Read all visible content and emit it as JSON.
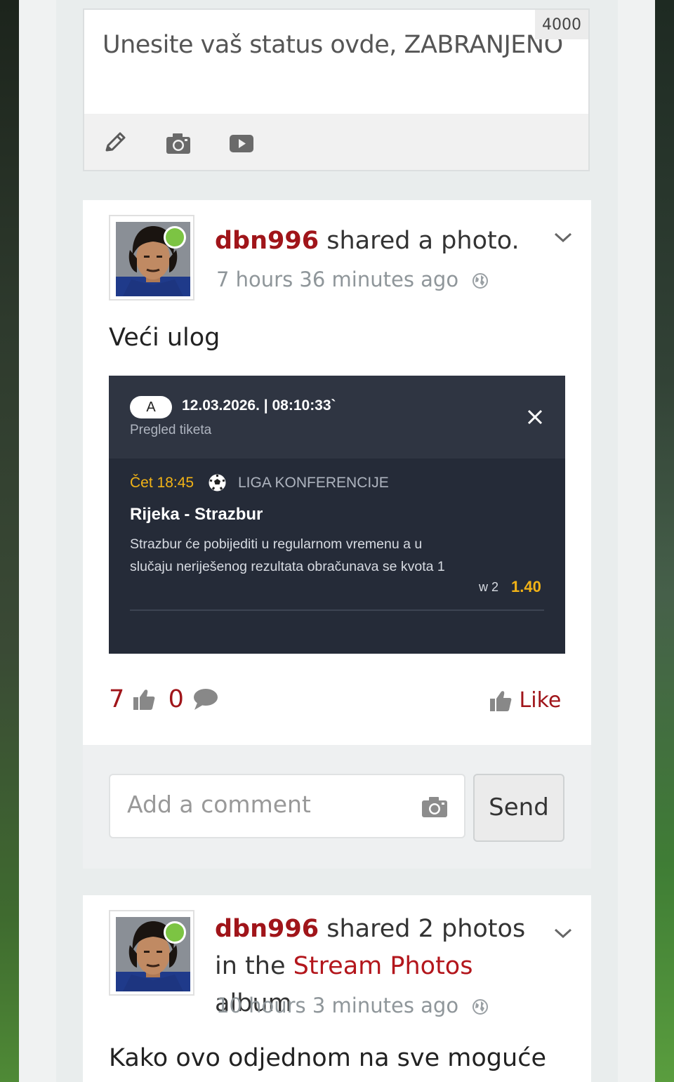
{
  "composer": {
    "placeholder": "Unesite vaš status ovde, ZABRANJENO",
    "char_counter": "4000",
    "tools": [
      "pencil-icon",
      "camera-icon",
      "video-icon"
    ]
  },
  "posts": [
    {
      "author": "dbn996",
      "action": "shared a photo.",
      "time_ago": "7 hours 36 minutes ago",
      "text": "Veći ulog",
      "ticket": {
        "badge": "A",
        "datetime": "12.03.2026. | 08:10:33`",
        "subtitle": "Pregled tiketa",
        "match_time": "Čet 18:45",
        "league": "LIGA KONFERENCIJE",
        "match": "Rijeka - Strazbur",
        "description": "Strazbur će pobijediti u regularnom vremenu a u slučaju neriješenog rezultata obračunava se kvota 1",
        "pick": "w 2",
        "odd": "1.40"
      },
      "likes": "7",
      "comments": "0",
      "like_label": "Like"
    },
    {
      "author": "dbn996",
      "action_prefix": "shared 2 photos in the",
      "album_link": "Stream Photos",
      "action_suffix": "album",
      "time_ago": "10 hours 3 minutes ago",
      "text": "Kako ovo odjednom na sve moguće"
    }
  ],
  "comment_box": {
    "placeholder": "Add a comment",
    "send_label": "Send"
  },
  "colors": {
    "accent": "#a0151a",
    "online": "#7cc443",
    "ticket_bg": "#252b38",
    "odd": "#f2b316"
  }
}
